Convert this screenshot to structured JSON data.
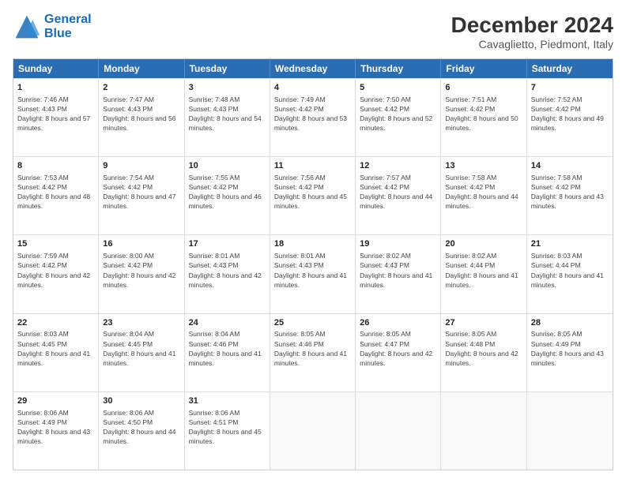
{
  "header": {
    "logo_line1": "General",
    "logo_line2": "Blue",
    "main_title": "December 2024",
    "subtitle": "Cavaglietto, Piedmont, Italy"
  },
  "weekdays": [
    "Sunday",
    "Monday",
    "Tuesday",
    "Wednesday",
    "Thursday",
    "Friday",
    "Saturday"
  ],
  "rows": [
    [
      {
        "day": "1",
        "rise": "7:46 AM",
        "set": "4:43 PM",
        "daylight": "8 hours and 57 minutes."
      },
      {
        "day": "2",
        "rise": "7:47 AM",
        "set": "4:43 PM",
        "daylight": "8 hours and 56 minutes."
      },
      {
        "day": "3",
        "rise": "7:48 AM",
        "set": "4:43 PM",
        "daylight": "8 hours and 54 minutes."
      },
      {
        "day": "4",
        "rise": "7:49 AM",
        "set": "4:42 PM",
        "daylight": "8 hours and 53 minutes."
      },
      {
        "day": "5",
        "rise": "7:50 AM",
        "set": "4:42 PM",
        "daylight": "8 hours and 52 minutes."
      },
      {
        "day": "6",
        "rise": "7:51 AM",
        "set": "4:42 PM",
        "daylight": "8 hours and 50 minutes."
      },
      {
        "day": "7",
        "rise": "7:52 AM",
        "set": "4:42 PM",
        "daylight": "8 hours and 49 minutes."
      }
    ],
    [
      {
        "day": "8",
        "rise": "7:53 AM",
        "set": "4:42 PM",
        "daylight": "8 hours and 48 minutes."
      },
      {
        "day": "9",
        "rise": "7:54 AM",
        "set": "4:42 PM",
        "daylight": "8 hours and 47 minutes."
      },
      {
        "day": "10",
        "rise": "7:55 AM",
        "set": "4:42 PM",
        "daylight": "8 hours and 46 minutes."
      },
      {
        "day": "11",
        "rise": "7:56 AM",
        "set": "4:42 PM",
        "daylight": "8 hours and 45 minutes."
      },
      {
        "day": "12",
        "rise": "7:57 AM",
        "set": "4:42 PM",
        "daylight": "8 hours and 44 minutes."
      },
      {
        "day": "13",
        "rise": "7:58 AM",
        "set": "4:42 PM",
        "daylight": "8 hours and 44 minutes."
      },
      {
        "day": "14",
        "rise": "7:58 AM",
        "set": "4:42 PM",
        "daylight": "8 hours and 43 minutes."
      }
    ],
    [
      {
        "day": "15",
        "rise": "7:59 AM",
        "set": "4:42 PM",
        "daylight": "8 hours and 42 minutes."
      },
      {
        "day": "16",
        "rise": "8:00 AM",
        "set": "4:42 PM",
        "daylight": "8 hours and 42 minutes."
      },
      {
        "day": "17",
        "rise": "8:01 AM",
        "set": "4:43 PM",
        "daylight": "8 hours and 42 minutes."
      },
      {
        "day": "18",
        "rise": "8:01 AM",
        "set": "4:43 PM",
        "daylight": "8 hours and 41 minutes."
      },
      {
        "day": "19",
        "rise": "8:02 AM",
        "set": "4:43 PM",
        "daylight": "8 hours and 41 minutes."
      },
      {
        "day": "20",
        "rise": "8:02 AM",
        "set": "4:44 PM",
        "daylight": "8 hours and 41 minutes."
      },
      {
        "day": "21",
        "rise": "8:03 AM",
        "set": "4:44 PM",
        "daylight": "8 hours and 41 minutes."
      }
    ],
    [
      {
        "day": "22",
        "rise": "8:03 AM",
        "set": "4:45 PM",
        "daylight": "8 hours and 41 minutes."
      },
      {
        "day": "23",
        "rise": "8:04 AM",
        "set": "4:45 PM",
        "daylight": "8 hours and 41 minutes."
      },
      {
        "day": "24",
        "rise": "8:04 AM",
        "set": "4:46 PM",
        "daylight": "8 hours and 41 minutes."
      },
      {
        "day": "25",
        "rise": "8:05 AM",
        "set": "4:46 PM",
        "daylight": "8 hours and 41 minutes."
      },
      {
        "day": "26",
        "rise": "8:05 AM",
        "set": "4:47 PM",
        "daylight": "8 hours and 42 minutes."
      },
      {
        "day": "27",
        "rise": "8:05 AM",
        "set": "4:48 PM",
        "daylight": "8 hours and 42 minutes."
      },
      {
        "day": "28",
        "rise": "8:05 AM",
        "set": "4:49 PM",
        "daylight": "8 hours and 43 minutes."
      }
    ],
    [
      {
        "day": "29",
        "rise": "8:06 AM",
        "set": "4:49 PM",
        "daylight": "8 hours and 43 minutes."
      },
      {
        "day": "30",
        "rise": "8:06 AM",
        "set": "4:50 PM",
        "daylight": "8 hours and 44 minutes."
      },
      {
        "day": "31",
        "rise": "8:06 AM",
        "set": "4:51 PM",
        "daylight": "8 hours and 45 minutes."
      },
      null,
      null,
      null,
      null
    ]
  ]
}
